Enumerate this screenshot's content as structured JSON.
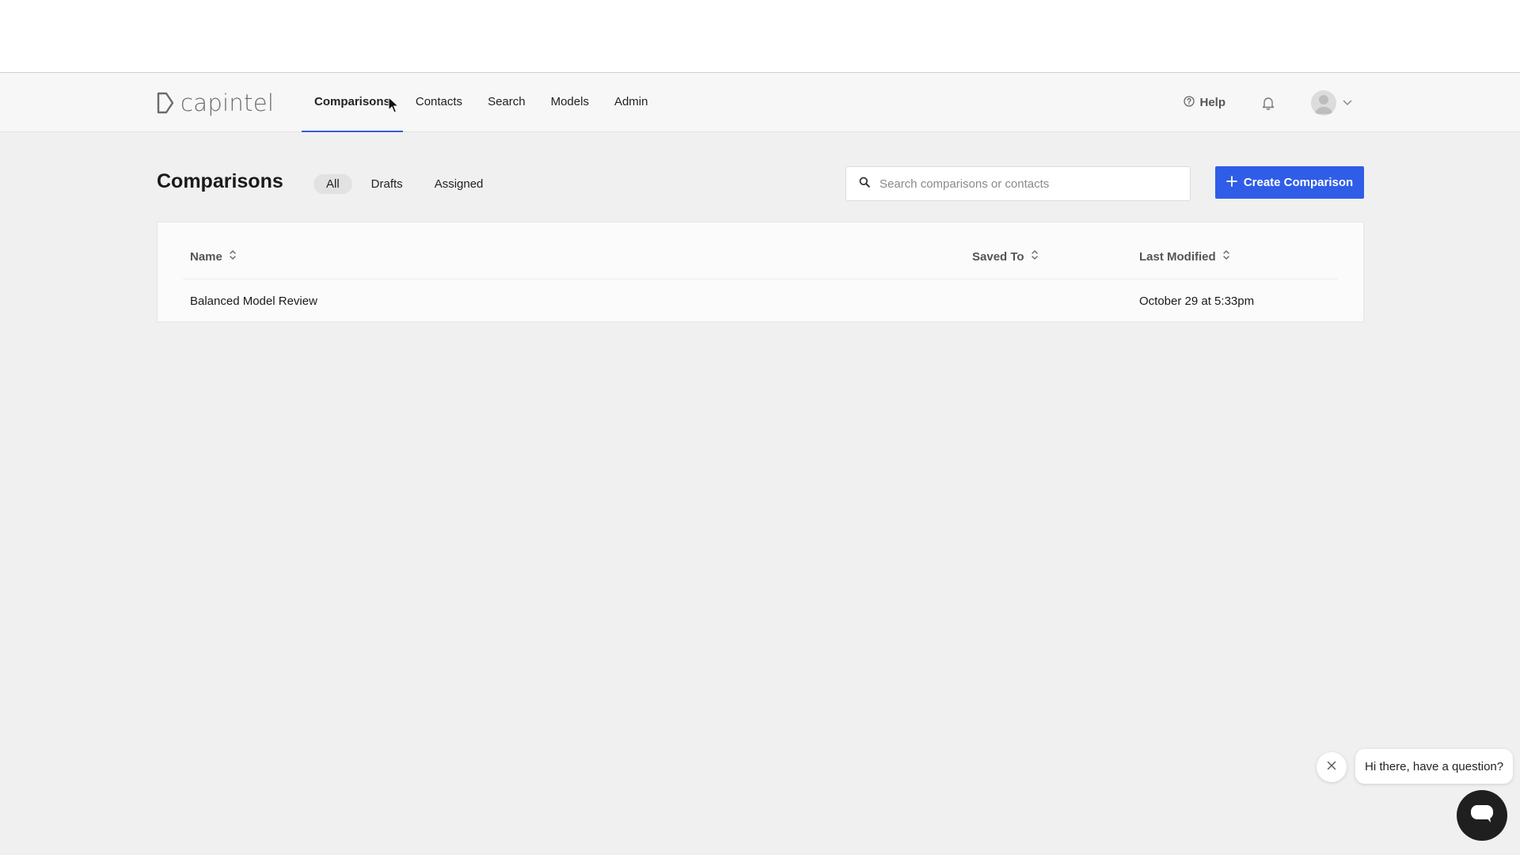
{
  "app": {
    "brand": "capintel"
  },
  "nav": {
    "links": [
      {
        "label": "Comparisons",
        "active": true
      },
      {
        "label": "Contacts",
        "active": false
      },
      {
        "label": "Search",
        "active": false
      },
      {
        "label": "Models",
        "active": false
      },
      {
        "label": "Admin",
        "active": false
      }
    ],
    "help_label": "Help"
  },
  "page": {
    "title": "Comparisons",
    "filters": [
      {
        "label": "All",
        "active": true
      },
      {
        "label": "Drafts",
        "active": false
      },
      {
        "label": "Assigned",
        "active": false
      }
    ],
    "search_placeholder": "Search comparisons or contacts",
    "search_value": "",
    "create_button_label": "Create Comparison"
  },
  "table": {
    "columns": [
      {
        "label": "Name"
      },
      {
        "label": "Saved To"
      },
      {
        "label": "Last Modified"
      }
    ],
    "rows": [
      {
        "name": "Balanced Model Review",
        "saved_to": "",
        "last_modified": "October 29 at 5:33pm"
      }
    ]
  },
  "chat": {
    "greeting": "Hi there, have a question?"
  },
  "colors": {
    "accent": "#2f5de8",
    "active_tab_underline": "#3a5bd9",
    "background": "#f0f0f0"
  }
}
